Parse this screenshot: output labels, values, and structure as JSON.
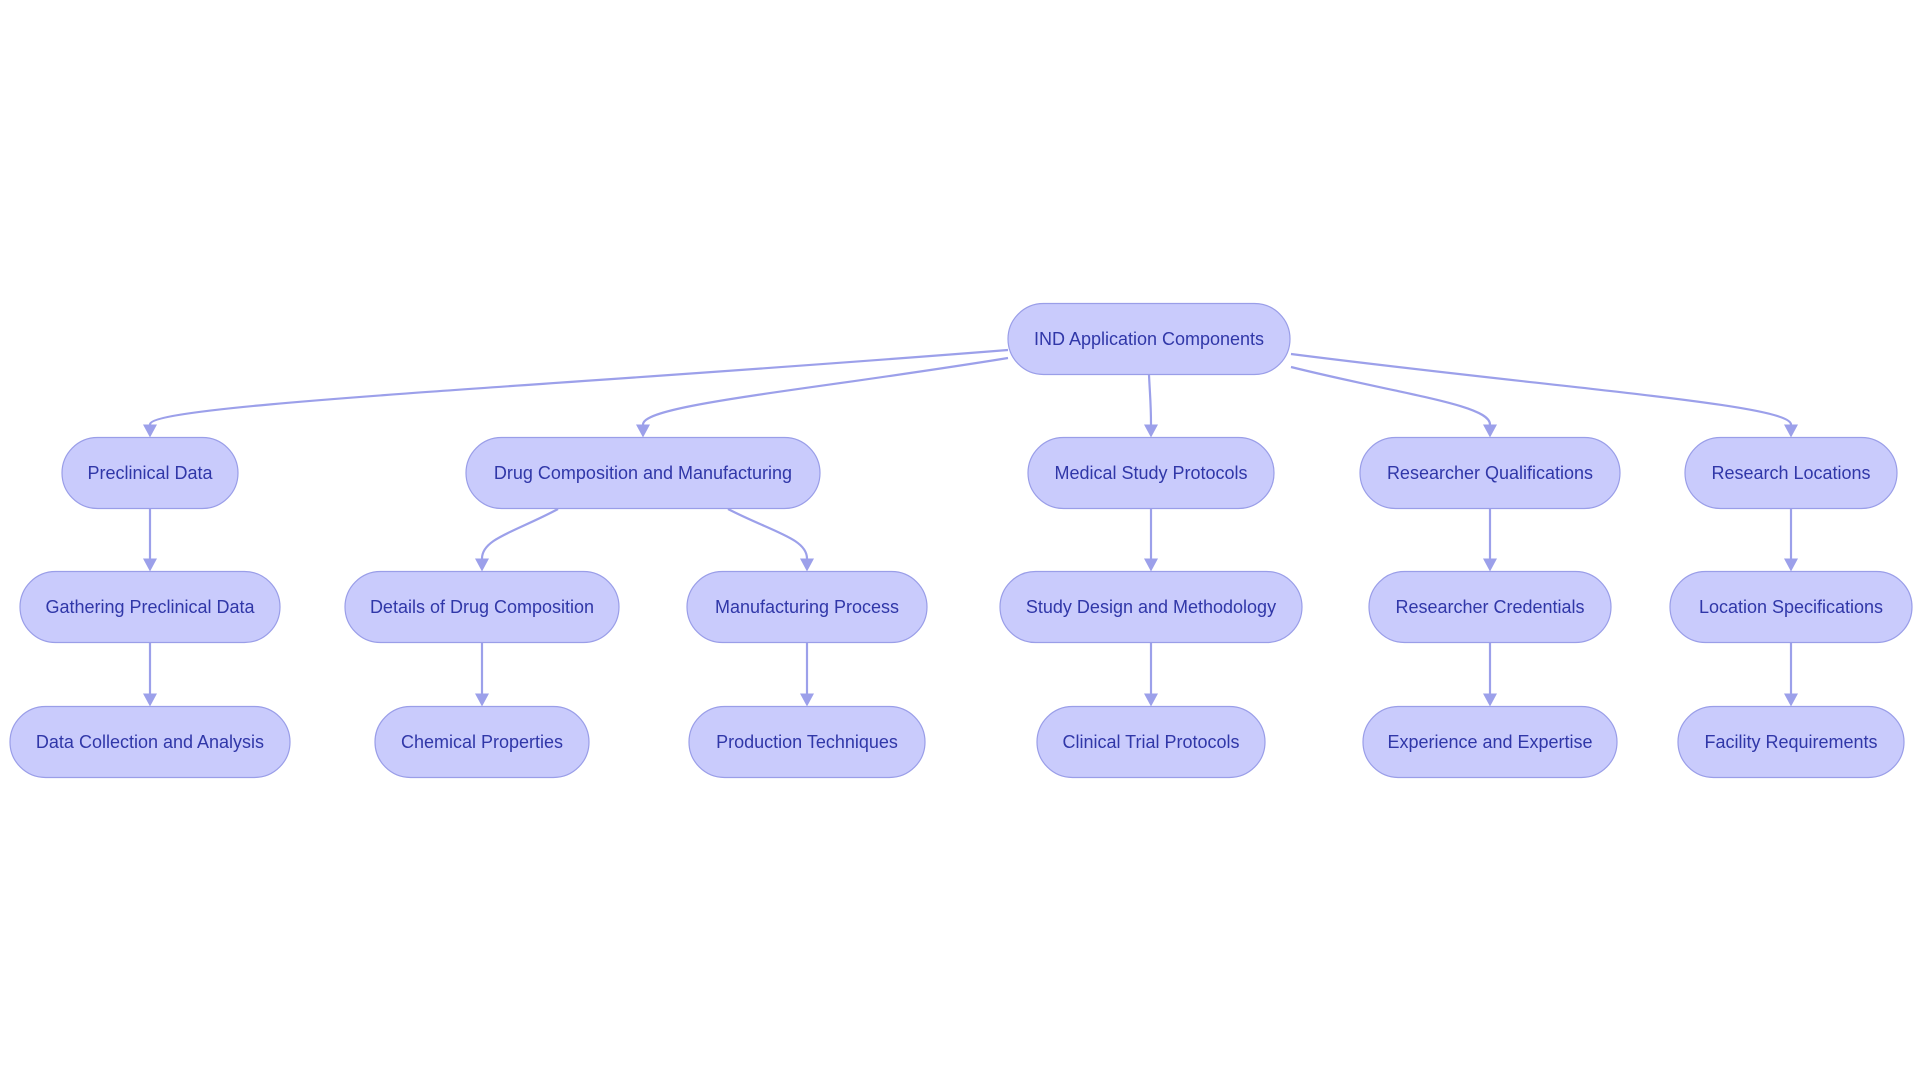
{
  "diagram": {
    "type": "flowchart-tree",
    "colors": {
      "node_fill": "#c9cbfc",
      "node_stroke": "#9a9ee8",
      "text": "#3037a8",
      "edge": "#9ca0ea"
    },
    "nodes": [
      {
        "id": "root",
        "label": "IND Application Components"
      },
      {
        "id": "pre",
        "label": "Preclinical Data"
      },
      {
        "id": "drug",
        "label": "Drug Composition and Manufacturing"
      },
      {
        "id": "med",
        "label": "Medical Study Protocols"
      },
      {
        "id": "res",
        "label": "Researcher Qualifications"
      },
      {
        "id": "loc",
        "label": "Research Locations"
      },
      {
        "id": "pre1",
        "label": "Gathering Preclinical Data"
      },
      {
        "id": "drug1",
        "label": "Details of Drug Composition"
      },
      {
        "id": "drug2",
        "label": "Manufacturing Process"
      },
      {
        "id": "med1",
        "label": "Study Design and Methodology"
      },
      {
        "id": "res1",
        "label": "Researcher Credentials"
      },
      {
        "id": "loc1",
        "label": "Location Specifications"
      },
      {
        "id": "pre2",
        "label": "Data Collection and Analysis"
      },
      {
        "id": "drug1a",
        "label": "Chemical Properties"
      },
      {
        "id": "drug2a",
        "label": "Production Techniques"
      },
      {
        "id": "med2",
        "label": "Clinical Trial Protocols"
      },
      {
        "id": "res2",
        "label": "Experience and Expertise"
      },
      {
        "id": "loc2",
        "label": "Facility Requirements"
      }
    ],
    "edges": [
      {
        "from": "root",
        "to": "pre"
      },
      {
        "from": "root",
        "to": "drug"
      },
      {
        "from": "root",
        "to": "med"
      },
      {
        "from": "root",
        "to": "res"
      },
      {
        "from": "root",
        "to": "loc"
      },
      {
        "from": "pre",
        "to": "pre1"
      },
      {
        "from": "pre1",
        "to": "pre2"
      },
      {
        "from": "drug",
        "to": "drug1"
      },
      {
        "from": "drug",
        "to": "drug2"
      },
      {
        "from": "drug1",
        "to": "drug1a"
      },
      {
        "from": "drug2",
        "to": "drug2a"
      },
      {
        "from": "med",
        "to": "med1"
      },
      {
        "from": "med1",
        "to": "med2"
      },
      {
        "from": "res",
        "to": "res1"
      },
      {
        "from": "res1",
        "to": "res2"
      },
      {
        "from": "loc",
        "to": "loc1"
      },
      {
        "from": "loc1",
        "to": "loc2"
      }
    ]
  }
}
